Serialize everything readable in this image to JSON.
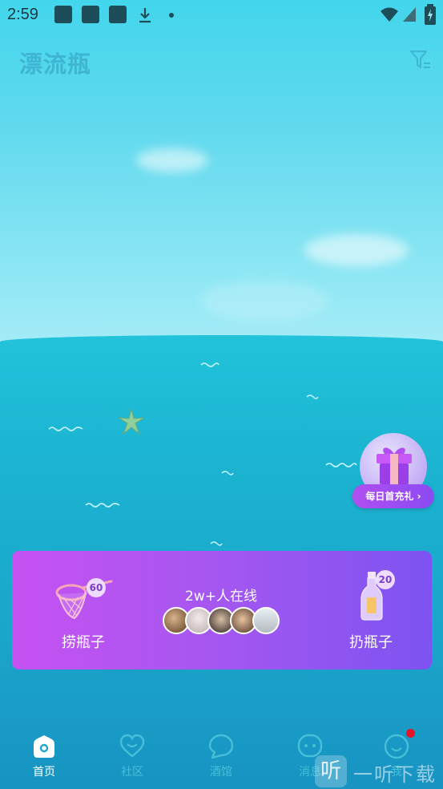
{
  "status_bar": {
    "time": "2:59",
    "icons": [
      "app-notification-icon",
      "app-notification-icon",
      "app-notification-icon",
      "download-icon",
      "dot-icon",
      "wifi-icon",
      "cellular-signal-icon",
      "battery-charging-icon"
    ]
  },
  "header": {
    "title": "漂流瓶",
    "filter_icon": "filter-icon"
  },
  "gift": {
    "label": "每日首充礼",
    "arrow": "›"
  },
  "panel": {
    "catch": {
      "label": "捞瓶子",
      "count": "60",
      "icon": "net-icon"
    },
    "online": {
      "text": "2w+人在线",
      "avatar_count": 5
    },
    "throw": {
      "label": "扔瓶子",
      "count": "20",
      "icon": "bottle-icon"
    }
  },
  "bottom_nav": {
    "items": [
      {
        "label": "首页",
        "icon": "home-icon",
        "active": true
      },
      {
        "label": "社区",
        "icon": "heart-icon",
        "active": false
      },
      {
        "label": "酒馆",
        "icon": "chat-bubble-icon",
        "active": false
      },
      {
        "label": "消息",
        "icon": "message-icon",
        "active": false
      },
      {
        "label": "我",
        "icon": "smile-icon",
        "active": false
      }
    ]
  },
  "watermark": {
    "badge": "听",
    "text": "一听下载"
  },
  "colors": {
    "title": "#3fb5d2",
    "panel_start": "#c652f2",
    "panel_end": "#7d53f1",
    "notification_dot": "#e8152a"
  }
}
